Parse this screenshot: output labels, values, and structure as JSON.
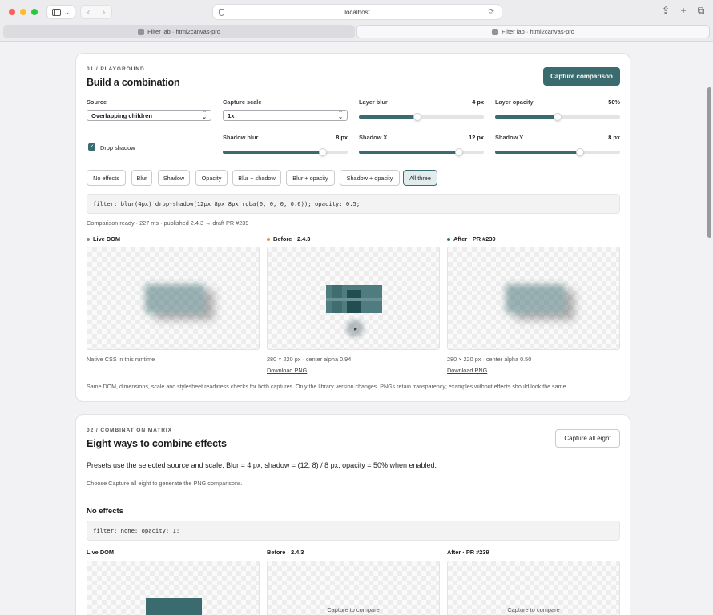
{
  "browser": {
    "url": "localhost",
    "tabs": [
      {
        "label": "Filter lab · html2canvas-pro"
      },
      {
        "label": "Filter lab · html2canvas-pro"
      }
    ]
  },
  "playground": {
    "eyebrow": "01 / PLAYGROUND",
    "title": "Build a combination",
    "capture_button": "Capture comparison",
    "source": {
      "label": "Source",
      "value": "Overlapping children"
    },
    "capture_scale": {
      "label": "Capture scale",
      "value": "1x"
    },
    "layer_blur": {
      "label": "Layer blur",
      "value": "4 px",
      "fraction": 0.47
    },
    "layer_opacity": {
      "label": "Layer opacity",
      "value": "50%",
      "fraction": 0.5
    },
    "shadow_blur": {
      "label": "Shadow blur",
      "value": "8 px",
      "fraction": 0.8
    },
    "shadow_x": {
      "label": "Shadow X",
      "value": "12 px",
      "fraction": 0.8
    },
    "shadow_y": {
      "label": "Shadow Y",
      "value": "8 px",
      "fraction": 0.68
    },
    "drop_shadow": {
      "label": "Drop shadow",
      "checked": true
    },
    "presets": [
      "No effects",
      "Blur",
      "Shadow",
      "Opacity",
      "Blur + shadow",
      "Blur + opacity",
      "Shadow + opacity",
      "All three"
    ],
    "active_preset": "All three",
    "css": "filter: blur(4px) drop-shadow(12px 8px 8px rgba(0, 0, 0, 0.6)); opacity: 0.5;",
    "status": "Comparison ready · 227 ms · published 2.4.3 → draft PR #239",
    "columns": [
      {
        "title": "Live DOM",
        "dot": "#8a8d91",
        "caption": "Native CSS in this runtime",
        "link": ""
      },
      {
        "title": "Before · 2.4.3",
        "dot": "#d99a3a",
        "caption": "280 × 220 px · center alpha 0.94",
        "link": "Download PNG"
      },
      {
        "title": "After · PR #239",
        "dot": "#3a6b6f",
        "caption": "280 × 220 px · center alpha 0.50",
        "link": "Download PNG"
      }
    ],
    "footnote": "Same DOM, dimensions, scale and stylesheet readiness checks for both captures. Only the library version changes. PNGs retain transparency; examples without effects should look the same."
  },
  "matrix": {
    "eyebrow": "02 / COMBINATION MATRIX",
    "title": "Eight ways to combine effects",
    "capture_all_button": "Capture all eight",
    "description": "Presets use the selected source and scale. Blur = 4 px, shadow = (12, 8) / 8 px, opacity = 50% when enabled.",
    "hint": "Choose Capture all eight to generate the PNG comparisons.",
    "section_title": "No effects",
    "css": "filter: none; opacity: 1;",
    "columns": [
      {
        "title": "Live DOM",
        "note": ""
      },
      {
        "title": "Before · 2.4.3",
        "note": "Capture to compare"
      },
      {
        "title": "After · PR #239",
        "note": "Capture to compare"
      }
    ]
  },
  "colors": {
    "accent": "#3a6b6f",
    "before_dot": "#d99a3a"
  }
}
